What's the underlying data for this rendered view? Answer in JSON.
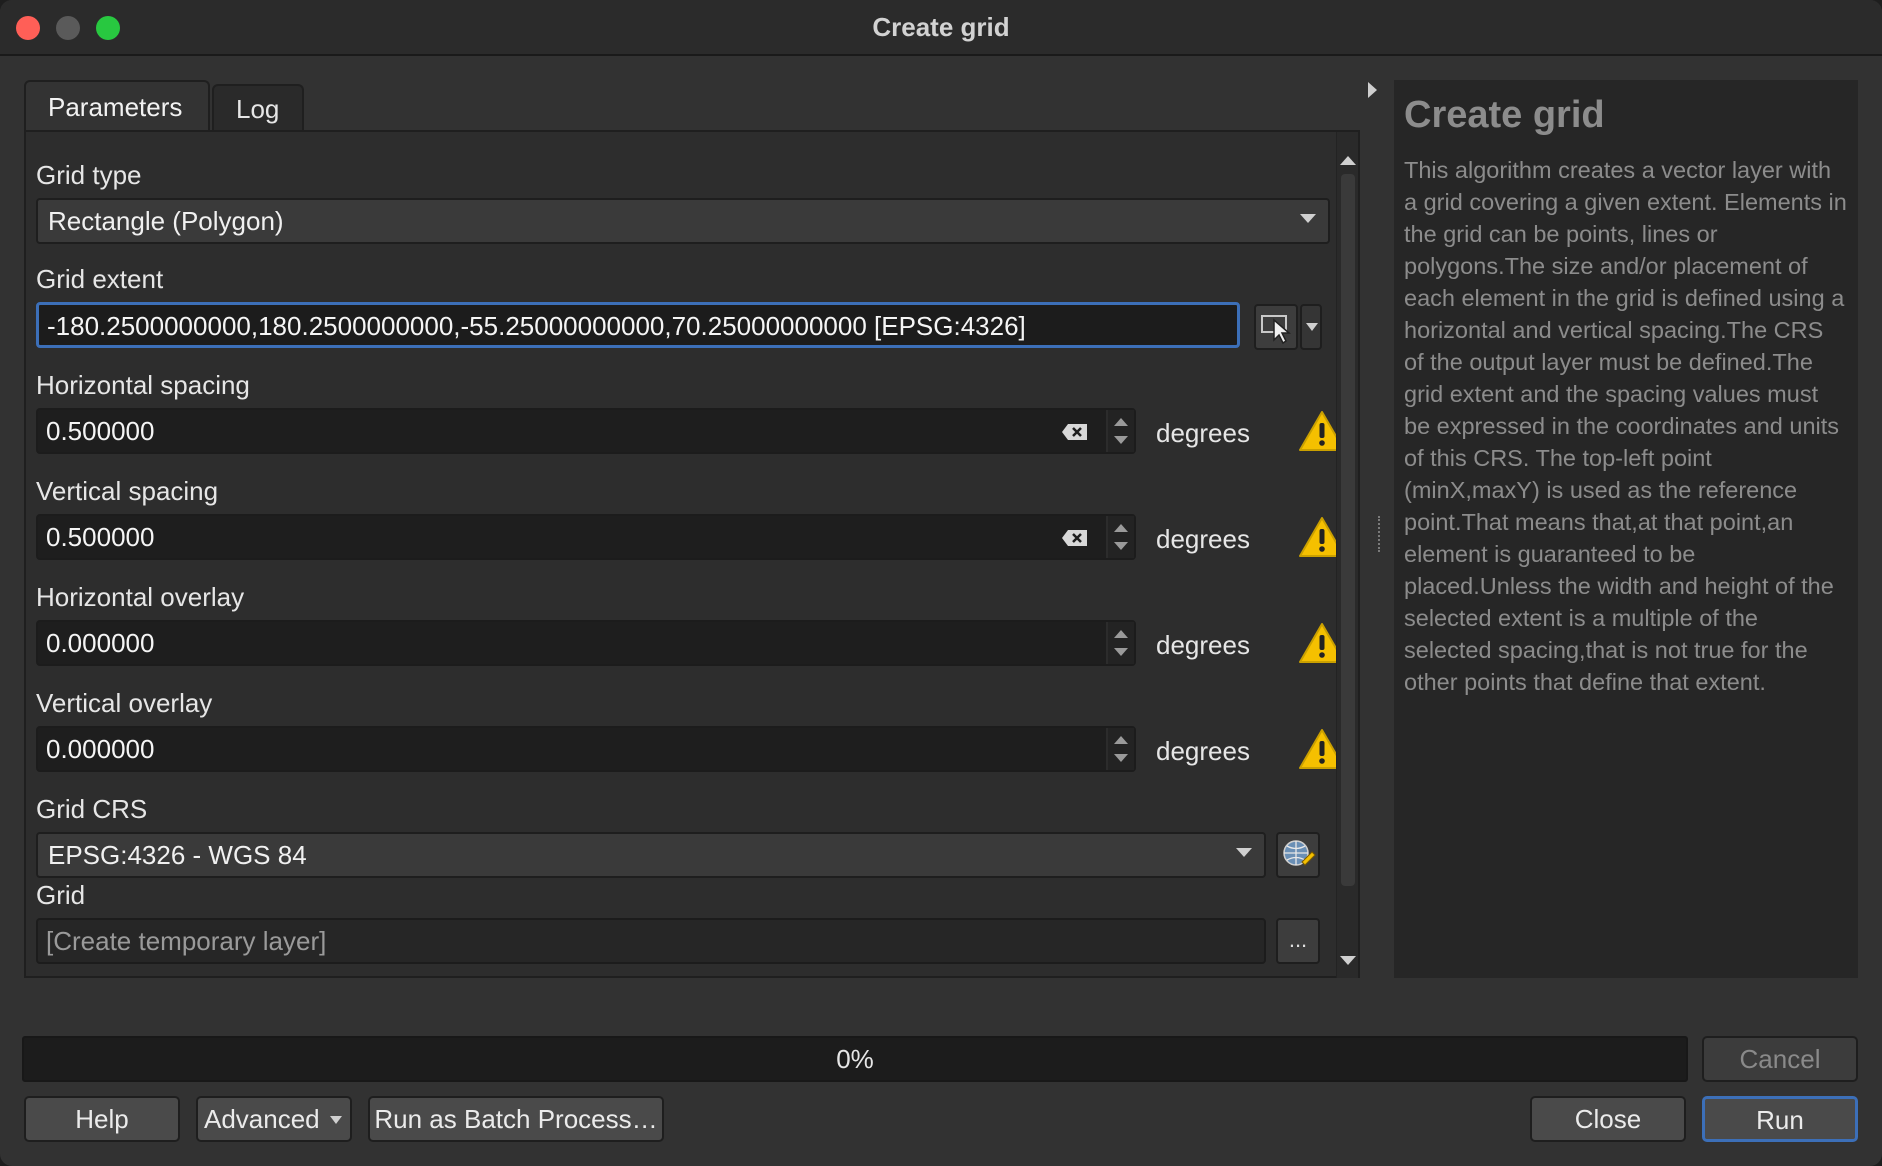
{
  "window": {
    "title": "Create grid"
  },
  "tabs": [
    {
      "label": "Parameters"
    },
    {
      "label": "Log"
    }
  ],
  "params": {
    "grid_type": {
      "label": "Grid type",
      "value": "Rectangle (Polygon)"
    },
    "grid_extent": {
      "label": "Grid extent",
      "value": "-180.2500000000,180.2500000000,-55.25000000000,70.25000000000 [EPSG:4326]"
    },
    "h_spacing": {
      "label": "Horizontal spacing",
      "value": "0.500000",
      "unit": "degrees"
    },
    "v_spacing": {
      "label": "Vertical spacing",
      "value": "0.500000",
      "unit": "degrees"
    },
    "h_overlay": {
      "label": "Horizontal overlay",
      "value": "0.000000",
      "unit": "degrees"
    },
    "v_overlay": {
      "label": "Vertical overlay",
      "value": "0.000000",
      "unit": "degrees"
    },
    "grid_crs": {
      "label": "Grid CRS",
      "value": "EPSG:4326 - WGS 84"
    },
    "grid_output": {
      "label": "Grid",
      "placeholder": "[Create temporary layer]",
      "browse_label": "..."
    }
  },
  "help": {
    "title": "Create grid",
    "text": "This algorithm creates a vector layer with a grid covering a given extent. Elements in the grid can be points, lines or polygons.The size and/or placement of each element in the grid is defined using a horizontal and vertical spacing.The CRS of the output layer must be defined.The grid extent and the spacing values must be expressed in the coordinates and units of this CRS. The top-left point (minX,maxY) is used as the reference point.That means that,at that point,an element is guaranteed to be placed.Unless the width and height of the selected extent is a multiple of the selected spacing,that is not true for the other points that define that extent."
  },
  "progress": {
    "value": 0,
    "text": "0%"
  },
  "buttons": {
    "cancel": "Cancel",
    "help": "Help",
    "advanced": "Advanced",
    "batch": "Run as Batch Process…",
    "close": "Close",
    "run": "Run"
  },
  "colors": {
    "accent": "#3c6fb8",
    "warning": "#f5c000"
  }
}
